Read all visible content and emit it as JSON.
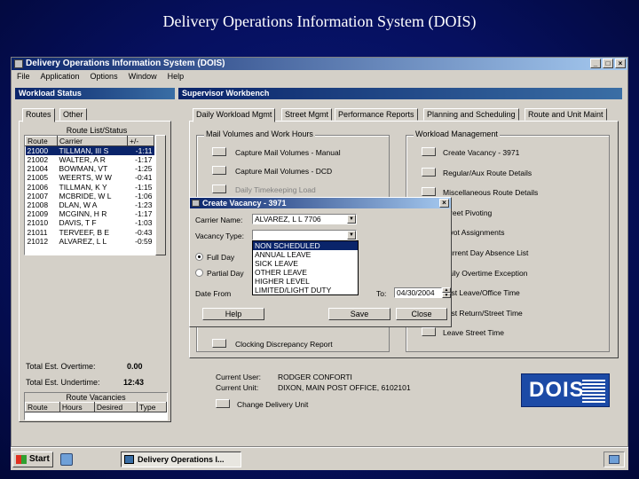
{
  "slide_title": "Delivery Operations Information System (DOIS)",
  "window": {
    "title": "Delivery Operations Information System (DOIS)",
    "controls": {
      "minimize": "_",
      "maximize": "□",
      "close": "×"
    }
  },
  "menu": [
    "File",
    "Application",
    "Options",
    "Window",
    "Help"
  ],
  "workload_status": {
    "header": "Workload Status",
    "tabs": [
      "Routes",
      "Other"
    ],
    "route_list_title": "Route List/Status",
    "columns": [
      "Route",
      "Carrier",
      "+/-"
    ],
    "rows": [
      {
        "route": "21000",
        "carrier": "TILLMAN, III S",
        "diff": "-1:11"
      },
      {
        "route": "21002",
        "carrier": "WALTER, A R",
        "diff": "-1:17"
      },
      {
        "route": "21004",
        "carrier": "BOWMAN, VT",
        "diff": "-1:25"
      },
      {
        "route": "21005",
        "carrier": "WEERTS, W W",
        "diff": "-0:41"
      },
      {
        "route": "21006",
        "carrier": "TILLMAN, K Y",
        "diff": "-1:15"
      },
      {
        "route": "21007",
        "carrier": "MCBRIDE, W L",
        "diff": "-1:06"
      },
      {
        "route": "21008",
        "carrier": "DLAN, W A",
        "diff": "-1:23"
      },
      {
        "route": "21009",
        "carrier": "MCGINN, H R",
        "diff": "-1:17"
      },
      {
        "route": "21010",
        "carrier": "DAVIS, T F",
        "diff": "-1:03"
      },
      {
        "route": "21011",
        "carrier": "TERVEEF, B E",
        "diff": "-0:43"
      },
      {
        "route": "21012",
        "carrier": "ALVAREZ, L L",
        "diff": "-0:59"
      }
    ],
    "total_overtime_label": "Total Est. Overtime:",
    "total_overtime_value": "0.00",
    "total_undertime_label": "Total Est. Undertime:",
    "total_undertime_value": "12:43",
    "route_vacancies_title": "Route Vacancies",
    "vacancy_columns": [
      "Route",
      "Hours",
      "Desired",
      "Type"
    ]
  },
  "workbench": {
    "header": "Supervisor Workbench",
    "tabs": [
      "Daily Workload Mgmt",
      "Street Mgmt",
      "Performance Reports",
      "Planning and Scheduling",
      "Route and Unit Maint"
    ],
    "mail_volumes": {
      "group_label": "Mail Volumes and Work Hours",
      "items": [
        "Capture Mail Volumes - Manual",
        "Capture Mail Volumes - DCD",
        "Daily Timekeeping Load"
      ]
    },
    "clocking_report": "Clocking Discrepancy Report",
    "workload_mgmt": {
      "group_label": "Workload Management",
      "items": [
        "Create Vacancy - 3971",
        "Regular/Aux Route Details",
        "Miscellaneous Route Details",
        "Street Pivoting",
        "Pivot Assignments",
        "Current Day Absence List",
        "Daily Overtime Exception",
        "Last Leave/Office Time",
        "Last Return/Street Time",
        "Leave Street Time"
      ]
    },
    "current_user_label": "Current User:",
    "current_user": "RODGER CONFORTI",
    "current_unit_label": "Current Unit:",
    "current_unit": "DIXON, MAIN POST OFFICE, 6102101",
    "change_unit": "Change Delivery Unit"
  },
  "dialog": {
    "title": "Create Vacancy - 3971",
    "close": "×",
    "carrier_label": "Carrier Name:",
    "carrier_value": "ALVAREZ, L L   7706",
    "vacancy_type_label": "Vacancy Type:",
    "vacancy_type_value": "",
    "vacancy_options": [
      "NON SCHEDULED",
      "ANNUAL LEAVE",
      "SICK LEAVE",
      "OTHER LEAVE",
      "HIGHER LEVEL",
      "LIMITED/LIGHT DUTY"
    ],
    "full_day": "Full Day",
    "partial_day": "Partial Day",
    "date_from_label": "Date From",
    "to_label": "To:",
    "to_date": "04/30/2004",
    "help_button": "Help",
    "save_button": "Save",
    "close_button": "Close"
  },
  "logo_text": "DOIS",
  "taskbar": {
    "start": "Start",
    "task": "Delivery Operations I..."
  }
}
